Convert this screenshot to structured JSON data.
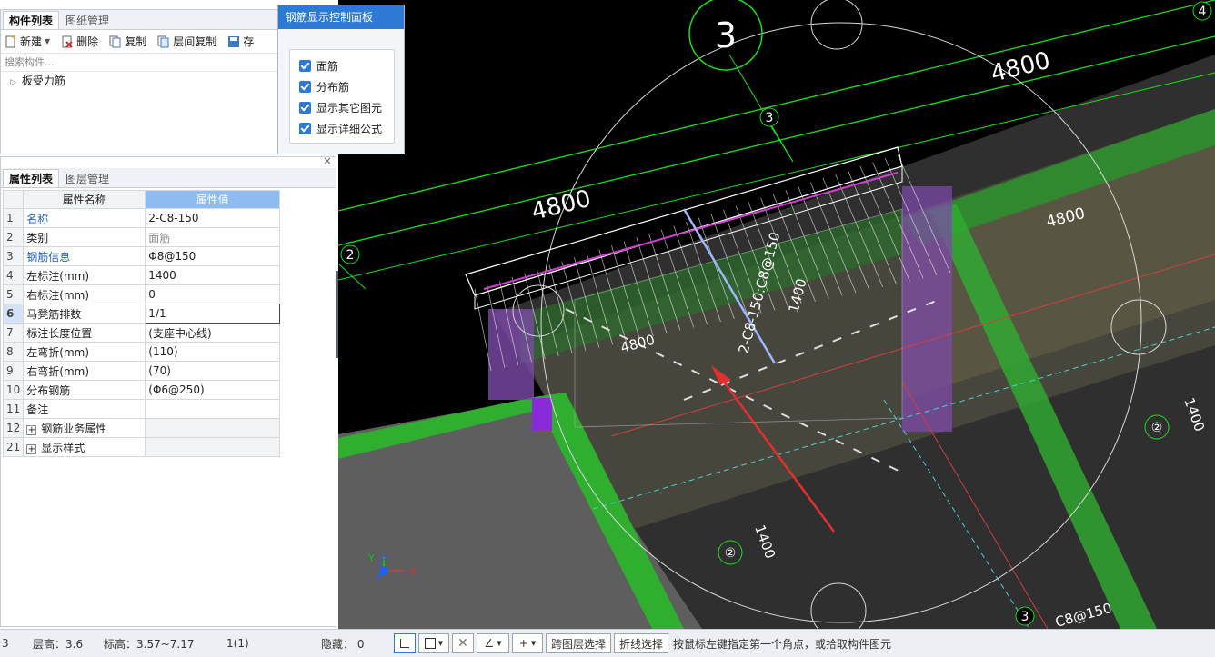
{
  "component_panel": {
    "tabs": [
      "构件列表",
      "图纸管理"
    ],
    "toolbar": {
      "new": "新建",
      "delete": "删除",
      "copy": "复制",
      "floor_copy": "层间复制",
      "save": "存"
    },
    "search_placeholder": "搜索构件...",
    "tree": [
      "板受力筋"
    ]
  },
  "property_panel": {
    "tabs": [
      "属性列表",
      "图层管理"
    ],
    "headers": {
      "name": "属性名称",
      "value": "属性值"
    },
    "rows": [
      {
        "num": "1",
        "name": "名称",
        "value": "2-C8-150",
        "name_color": "blue"
      },
      {
        "num": "2",
        "name": "类别",
        "value": "面筋",
        "value_color": "gray"
      },
      {
        "num": "3",
        "name": "钢筋信息",
        "value": "Φ8@150",
        "name_color": "blue"
      },
      {
        "num": "4",
        "name": "左标注(mm)",
        "value": "1400"
      },
      {
        "num": "5",
        "name": "右标注(mm)",
        "value": "0"
      },
      {
        "num": "6",
        "name": "马凳筋排数",
        "value": "1/1",
        "selected": true
      },
      {
        "num": "7",
        "name": "标注长度位置",
        "value": "(支座中心线)"
      },
      {
        "num": "8",
        "name": "左弯折(mm)",
        "value": "(110)"
      },
      {
        "num": "9",
        "name": "右弯折(mm)",
        "value": "(70)"
      },
      {
        "num": "10",
        "name": "分布钢筋",
        "value": "(Φ6@250)"
      },
      {
        "num": "11",
        "name": "备注",
        "value": ""
      },
      {
        "num": "12",
        "name": "钢筋业务属性",
        "value": "",
        "expand": true
      },
      {
        "num": "21",
        "name": "显示样式",
        "value": "",
        "expand": true
      }
    ],
    "close_icon": "×"
  },
  "control_panel": {
    "title": "钢筋显示控制面板",
    "checkboxes": [
      "面筋",
      "分布筋",
      "显示其它图元",
      "显示详细公式"
    ]
  },
  "viewport": {
    "axis_labels": {
      "a3_big": "3",
      "a3_small": "3",
      "a3_bottom": "3",
      "a2": "2",
      "a4": "4"
    },
    "dims": {
      "top": "4800",
      "left": "4800",
      "right": "4800"
    },
    "rebar_label": "2-C8-150:C8@150",
    "dim_1400": "1400",
    "dim_4800": "4800",
    "right_side": [
      "②",
      "1400"
    ],
    "bottom_side": [
      "②",
      "1400"
    ],
    "bottom_right_label": "C8@150",
    "axes": {
      "x": "X",
      "y": "Y",
      "z": "Z"
    }
  },
  "status": {
    "floor": "3",
    "floor_height": "层高：3.6",
    "elevation": "标高：3.57~7.17",
    "count": "1(1)",
    "hidden": "隐藏：  0",
    "cross_layer": "跨图层选择",
    "polyline": "折线选择",
    "hint": "按鼠标左键指定第一个角点，或拾取构件图元"
  }
}
